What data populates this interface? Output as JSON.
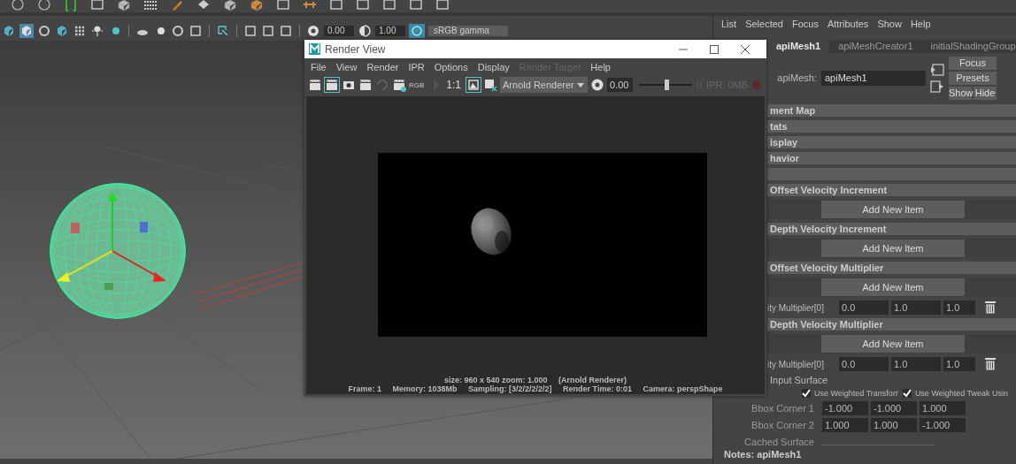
{
  "viewport_toolbar": {
    "exposure": "0.00",
    "gamma": "1.00",
    "color_space": "sRGB gamma"
  },
  "render_view": {
    "title": "Render View",
    "menu": [
      {
        "label": "File",
        "disabled": false
      },
      {
        "label": "View",
        "disabled": false
      },
      {
        "label": "Render",
        "disabled": false
      },
      {
        "label": "IPR",
        "disabled": false
      },
      {
        "label": "Options",
        "disabled": false
      },
      {
        "label": "Display",
        "disabled": false
      },
      {
        "label": "Render Target",
        "disabled": true
      },
      {
        "label": "Help",
        "disabled": false
      }
    ],
    "channels": "RGB",
    "ratio": "1:1",
    "renderer": "Arnold Renderer",
    "exposure": "0.00",
    "level": 0.52,
    "ipr": "IPR: 0MB",
    "status_lines": [
      "size: 960 x 540 zoom: 1.000     (Arnold Renderer)",
      "Frame: 1     Memory: 1038Mb     Sampling: [3/2/2/2/2/2]     Render Time: 0:01     Camera: perspShape"
    ]
  },
  "attribute_editor": {
    "menu": [
      "List",
      "Selected",
      "Focus",
      "Attributes",
      "Show",
      "Help"
    ],
    "tabs": [
      {
        "label": "apiMesh1",
        "selected": true
      },
      {
        "label": "apiMeshCreator1",
        "selected": false
      },
      {
        "label": "initialShadingGroup",
        "selected": false
      }
    ],
    "node_label": "apiMesh:",
    "node_name": "apiMesh1",
    "buttons": [
      "Focus",
      "Presets",
      "Show",
      "Hide"
    ],
    "rows": [
      {
        "kind": "header",
        "title": "ment Map"
      },
      {
        "kind": "header",
        "title": "tats"
      },
      {
        "kind": "header",
        "title": "isplay"
      },
      {
        "kind": "header",
        "title": "havior"
      },
      {
        "kind": "header"
      },
      {
        "kind": "header",
        "title": "Offset Velocity Increment"
      },
      {
        "kind": "button",
        "label": "Add New Item"
      },
      {
        "kind": "header",
        "title": "Depth Velocity Increment"
      },
      {
        "kind": "button",
        "label": "Add New Item"
      },
      {
        "kind": "header",
        "title": "Offset Velocity Multiplier"
      },
      {
        "kind": "button",
        "label": "Add New Item"
      },
      {
        "kind": "array",
        "label": "ity Multiplier[0]",
        "values": [
          "0.0",
          "1.0",
          "1.0"
        ]
      },
      {
        "kind": "header",
        "title": "Depth Velocity Multiplier"
      },
      {
        "kind": "button",
        "label": "Add New Item"
      },
      {
        "kind": "array",
        "label": "ity Multiplier[0]",
        "values": [
          "0.0",
          "1.0",
          "1.0"
        ]
      },
      {
        "kind": "label",
        "label": "Input Surface"
      },
      {
        "kind": "checks",
        "items": [
          {
            "label": "Use Weighted Transforr",
            "checked": true
          },
          {
            "label": "Use Weighted Tweak Usin",
            "checked": true
          }
        ]
      },
      {
        "kind": "vector",
        "label": "Bbox Corner 1",
        "values": [
          "-1.000",
          "-1.000",
          "1.000"
        ]
      },
      {
        "kind": "vector",
        "label": "Bbox Corner 2",
        "values": [
          "1.000",
          "1.000",
          "-1.000"
        ]
      },
      {
        "kind": "cached",
        "label": "Cached Surface"
      },
      {
        "kind": "notes",
        "label": "Notes:  apiMesh1"
      }
    ]
  }
}
